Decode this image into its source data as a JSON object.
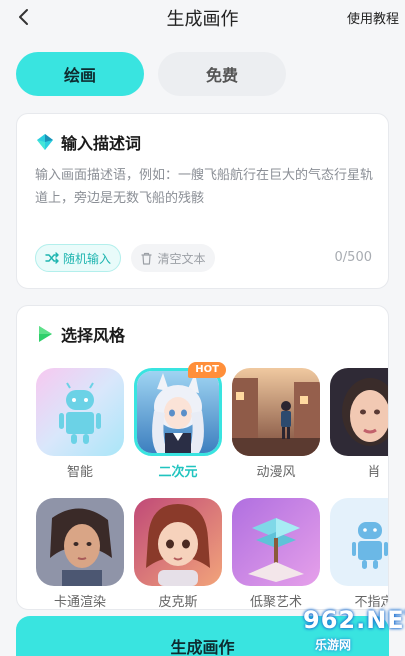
{
  "header": {
    "title": "生成画作",
    "help_label": "使用教程"
  },
  "mode_tabs": [
    {
      "label": "绘画",
      "active": true
    },
    {
      "label": "免费",
      "active": false
    }
  ],
  "prompt": {
    "heading": "输入描述词",
    "placeholder": "输入画面描述语，例如：一艘飞船航行在巨大的气态行星轨道上，旁边是无数飞船的残骸",
    "random_label": "随机输入",
    "clear_label": "清空文本",
    "counter": "0/500"
  },
  "style_section": {
    "heading": "选择风格",
    "hot_badge": "HOT",
    "items": [
      {
        "label": "智能",
        "selected": false
      },
      {
        "label": "二次元",
        "selected": true
      },
      {
        "label": "动漫风",
        "selected": false
      },
      {
        "label": "肖",
        "selected": false
      },
      {
        "label": "卡通渲染",
        "selected": false
      },
      {
        "label": "皮克斯",
        "selected": false
      },
      {
        "label": "低聚艺术",
        "selected": false
      },
      {
        "label": "不指定",
        "selected": false
      }
    ]
  },
  "generate_label": "生成画作",
  "watermark": {
    "number": "962.NET",
    "sub": "乐游网"
  },
  "colors": {
    "accent": "#39e4e0",
    "accent_text": "#20c4bf",
    "hot": "#ff8f3a"
  },
  "icons": [
    "back-chevron-icon",
    "diamond-icon",
    "play-triangle-icon",
    "shuffle-icon",
    "trash-icon",
    "android-robot-icon"
  ]
}
